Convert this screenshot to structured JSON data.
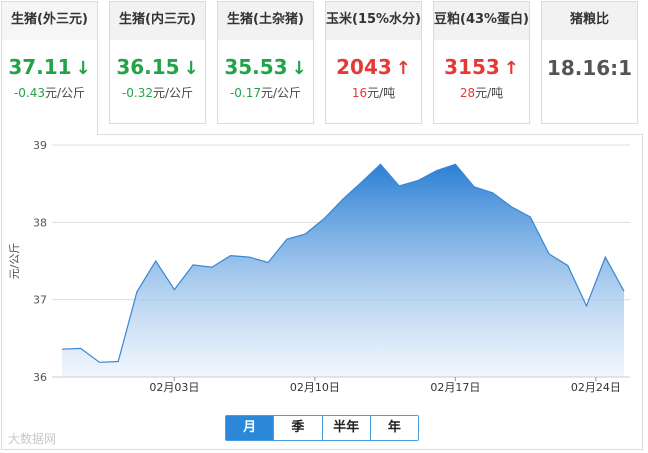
{
  "cards": [
    {
      "name": "生猪(外三元)",
      "price": "37.11",
      "direction": "down",
      "change": "-0.43",
      "unit": "元/公斤",
      "active": true
    },
    {
      "name": "生猪(内三元)",
      "price": "36.15",
      "direction": "down",
      "change": "-0.32",
      "unit": "元/公斤",
      "active": false
    },
    {
      "name": "生猪(土杂猪)",
      "price": "35.53",
      "direction": "down",
      "change": "-0.17",
      "unit": "元/公斤",
      "active": false
    },
    {
      "name": "玉米(15%水分)",
      "price": "2043",
      "direction": "up",
      "change": "16",
      "unit": "元/吨",
      "active": false
    },
    {
      "name": "豆粕(43%蛋白)",
      "price": "3153",
      "direction": "up",
      "change": "28",
      "unit": "元/吨",
      "active": false
    },
    {
      "name": "猪粮比",
      "price": "18.16:1",
      "direction": "neutral",
      "change": "",
      "unit": "",
      "active": false
    }
  ],
  "range_buttons": [
    {
      "label": "月",
      "active": true
    },
    {
      "label": "季",
      "active": false
    },
    {
      "label": "半年",
      "active": false
    },
    {
      "label": "年",
      "active": false
    }
  ],
  "watermark": "大数据网",
  "colors": {
    "up": "#e53935",
    "down": "#22a34a",
    "accent": "#2b88d9"
  },
  "chart_data": {
    "type": "area",
    "ylabel": "元/公斤",
    "ylim": [
      36,
      39
    ],
    "yticks": [
      36,
      37,
      38,
      39
    ],
    "x": [
      "01-29",
      "01-30",
      "01-31",
      "02-01",
      "02-02",
      "02-03",
      "02-04",
      "02-05",
      "02-06",
      "02-07",
      "02-08",
      "02-09",
      "02-10",
      "02-11",
      "02-12",
      "02-13",
      "02-14",
      "02-15",
      "02-16",
      "02-17",
      "02-18",
      "02-19",
      "02-20",
      "02-21",
      "02-22",
      "02-23",
      "02-24",
      "02-25",
      "02-26"
    ],
    "xtick_labels": [
      "02月03日",
      "02月10日",
      "02月17日",
      "02月24日"
    ],
    "xtick_dates": [
      "02-03",
      "02-10",
      "02-17",
      "02-24"
    ],
    "series": [
      {
        "values": [
          36.36,
          36.37,
          36.19,
          36.2,
          37.1,
          37.5,
          37.13,
          37.45,
          37.42,
          37.57,
          37.55,
          37.48,
          37.78,
          37.85,
          38.05,
          38.3,
          38.52,
          38.75,
          38.47,
          38.54,
          38.67,
          38.75,
          38.46,
          38.38,
          38.2,
          38.07,
          37.59,
          37.44,
          36.92,
          37.55,
          37.11
        ]
      }
    ],
    "grid": true
  }
}
